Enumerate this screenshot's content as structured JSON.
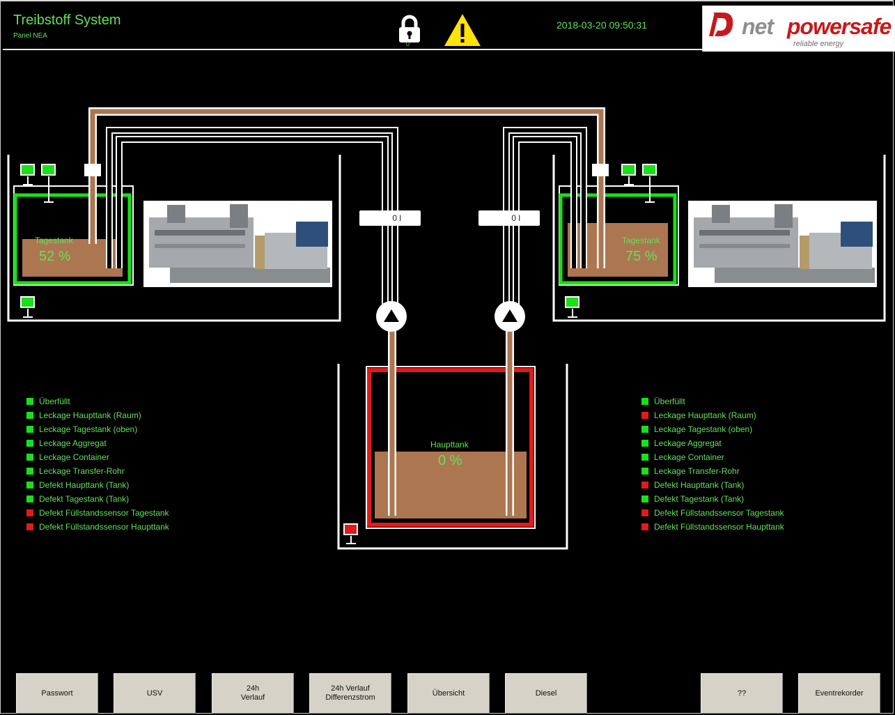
{
  "header": {
    "title": "Treibstoff System",
    "subtitle": "Panel NEA",
    "lock_count": "0",
    "datetime": "2018-03-20  09:50:31",
    "logo_text_1": "net",
    "logo_text_2": "powersafe",
    "logo_tagline": "reliable energy"
  },
  "tanks": {
    "left": {
      "label": "Tagestank",
      "percent_text": "52 %",
      "level": 0.52,
      "status": "ok"
    },
    "right": {
      "label": "Tagestank",
      "percent_text": "75 %",
      "level": 0.75,
      "status": "ok"
    },
    "main": {
      "label": "Haupttank",
      "percent_text": "0 %",
      "status": "alarm"
    }
  },
  "counters": {
    "left": "0 l",
    "right": "0 l"
  },
  "status_lists": {
    "left": [
      {
        "label": "Überfüllt",
        "state": "ok"
      },
      {
        "label": "Leckage Haupttank (Raum)",
        "state": "ok"
      },
      {
        "label": "Leckage Tagestank (oben)",
        "state": "ok"
      },
      {
        "label": "Leckage Aggregat",
        "state": "ok"
      },
      {
        "label": "Leckage Container",
        "state": "ok"
      },
      {
        "label": "Leckage Transfer-Rohr",
        "state": "ok"
      },
      {
        "label": "Defekt Haupttank (Tank)",
        "state": "ok"
      },
      {
        "label": "Defekt Tagestank (Tank)",
        "state": "ok"
      },
      {
        "label": "Defekt Füllstandssensor Tagestank",
        "state": "alarm"
      },
      {
        "label": "Defekt Füllstandssensor Haupttank",
        "state": "alarm"
      }
    ],
    "right": [
      {
        "label": "Überfüllt",
        "state": "ok"
      },
      {
        "label": "Leckage Haupttank (Raum)",
        "state": "alarm"
      },
      {
        "label": "Leckage Tagestank (oben)",
        "state": "ok"
      },
      {
        "label": "Leckage Aggregat",
        "state": "ok"
      },
      {
        "label": "Leckage Container",
        "state": "ok"
      },
      {
        "label": "Leckage Transfer-Rohr",
        "state": "ok"
      },
      {
        "label": "Defekt Haupttank (Tank)",
        "state": "alarm"
      },
      {
        "label": "Defekt Tagestank (Tank)",
        "state": "ok"
      },
      {
        "label": "Defekt Füllstandssensor Tagestank",
        "state": "alarm"
      },
      {
        "label": "Defekt Füllstandssensor Haupttank",
        "state": "alarm"
      }
    ]
  },
  "buttons": [
    {
      "label": "Passwort"
    },
    {
      "label": "USV"
    },
    {
      "label": "24h\nVerlauf"
    },
    {
      "label": "24h Verlauf\nDifferenzstrom"
    },
    {
      "label": "Übersicht"
    },
    {
      "label": "Diesel"
    },
    {
      "label": "??"
    },
    {
      "label": "Eventrekorder"
    }
  ],
  "colors": {
    "ok": "#19e019",
    "alarm": "#e01b1b",
    "fuel": "#ac7650",
    "text": "#61e25a"
  }
}
